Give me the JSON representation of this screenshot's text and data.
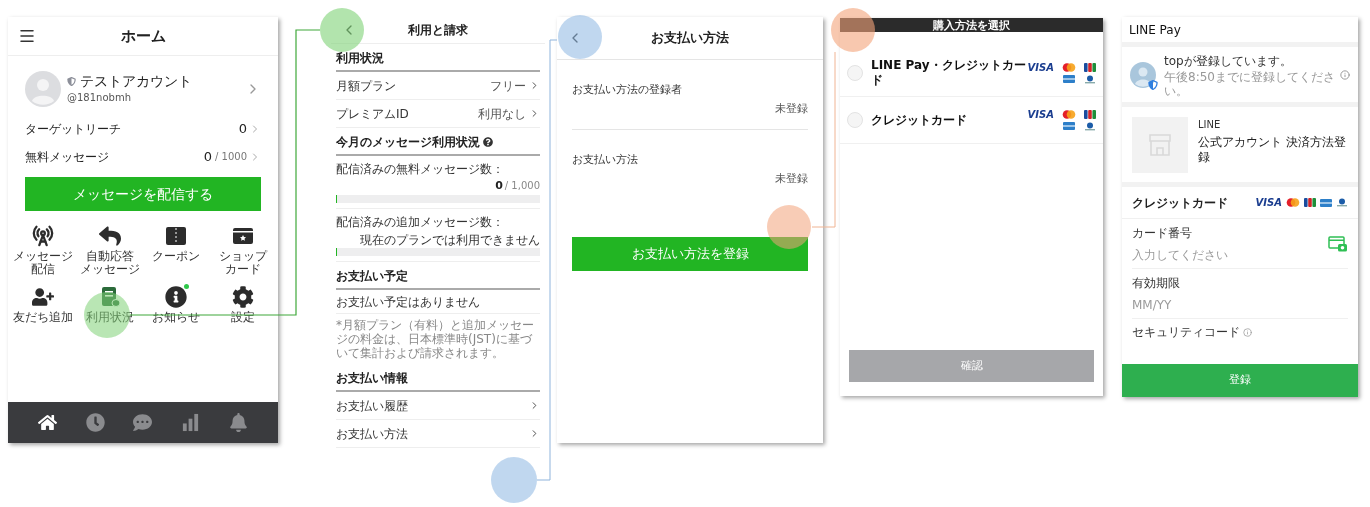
{
  "home": {
    "title": "ホーム",
    "account": {
      "name": "テストアカウント",
      "handle": "@181nobmh"
    },
    "stats": [
      {
        "label": "ターゲットリーチ",
        "value": "0"
      },
      {
        "label": "無料メッセージ",
        "value": "0",
        "total": "/ 1000"
      }
    ],
    "primary_button": "メッセージを配信する",
    "menu": [
      {
        "kind": "broadcast",
        "label_lines": [
          "メッセージ",
          "配信"
        ],
        "badge": false
      },
      {
        "kind": "reply",
        "label_lines": [
          "自動応答",
          "メッセージ"
        ],
        "badge": false
      },
      {
        "kind": "coupon",
        "label_lines": [
          "クーポン"
        ],
        "badge": false
      },
      {
        "kind": "shopcard",
        "label_lines": [
          "ショップ",
          "カード"
        ],
        "badge": false
      },
      {
        "kind": "friend",
        "label_lines": [
          "友だち追加"
        ],
        "badge": false
      },
      {
        "kind": "usage",
        "label_lines": [
          "利用状況"
        ],
        "badge": false
      },
      {
        "kind": "info",
        "label_lines": [
          "お知らせ"
        ],
        "badge": true
      },
      {
        "kind": "settings",
        "label_lines": [
          "設定"
        ],
        "badge": false
      }
    ],
    "tab_bar": [
      {
        "kind": "home",
        "selected": true
      },
      {
        "kind": "clock",
        "selected": false
      },
      {
        "kind": "chat",
        "selected": false
      },
      {
        "kind": "chart",
        "selected": false
      },
      {
        "kind": "bell",
        "selected": false
      }
    ]
  },
  "usage": {
    "title": "利用と請求",
    "items": [
      {
        "kind": "heading",
        "text": "利用状況"
      },
      {
        "kind": "link",
        "label": "月額プラン",
        "value": "フリー"
      },
      {
        "kind": "link",
        "label": "プレミアムID",
        "value": "利用なし"
      },
      {
        "kind": "heading",
        "text": "今月のメッセージ利用状況",
        "help": true
      },
      {
        "kind": "meter",
        "label": "配信済みの無料メッセージ数：",
        "value": "0",
        "total": "/ 1,000",
        "level": 0
      },
      {
        "kind": "meter",
        "label": "配信済みの追加メッセージ数：",
        "note": "現在のプランでは利用できません",
        "level": 0
      },
      {
        "kind": "heading",
        "text": "お支払い予定"
      },
      {
        "kind": "text",
        "text": "お支払い予定はありません"
      },
      {
        "kind": "note",
        "text": "*月額プラン（有料）と追加メッセージの料金は、日本標準時(JST)に基づいて集計および請求されます。"
      },
      {
        "kind": "heading",
        "text": "お支払い情報"
      },
      {
        "kind": "link",
        "label": "お支払い履歴"
      },
      {
        "kind": "link",
        "label": "お支払い方法"
      }
    ]
  },
  "payment_method": {
    "title": "お支払い方法",
    "fields": [
      {
        "label": "お支払い方法の登録者",
        "value": "未登録"
      },
      {
        "label": "お支払い方法",
        "value": "未登録"
      }
    ],
    "button": "お支払い方法を登録"
  },
  "purchase_select": {
    "title": "購入方法を選択",
    "options": [
      {
        "label": "LINE Pay・クレジットカード",
        "selected": false,
        "logo_text": "VISA"
      },
      {
        "label": "クレジットカード",
        "selected": false,
        "logo_text": "VISA"
      }
    ],
    "button": "確認",
    "button_disabled": true
  },
  "line_pay": {
    "title": "LINE Pay",
    "notice": {
      "title": "topが登録しています。",
      "subtitle": "午後8:50までに登録してください。"
    },
    "merchant": {
      "name": "LINE",
      "product": "公式アカウント 決済方法登録"
    },
    "card_section": {
      "title": "クレジットカード",
      "logo_text": "VISA",
      "fields": [
        {
          "label": "カード番号",
          "placeholder": "入力してください",
          "camera": true
        },
        {
          "label": "有効期限",
          "placeholder": "MM/YY"
        },
        {
          "label": "セキュリティコード",
          "help": true
        }
      ]
    },
    "button": "登録"
  }
}
